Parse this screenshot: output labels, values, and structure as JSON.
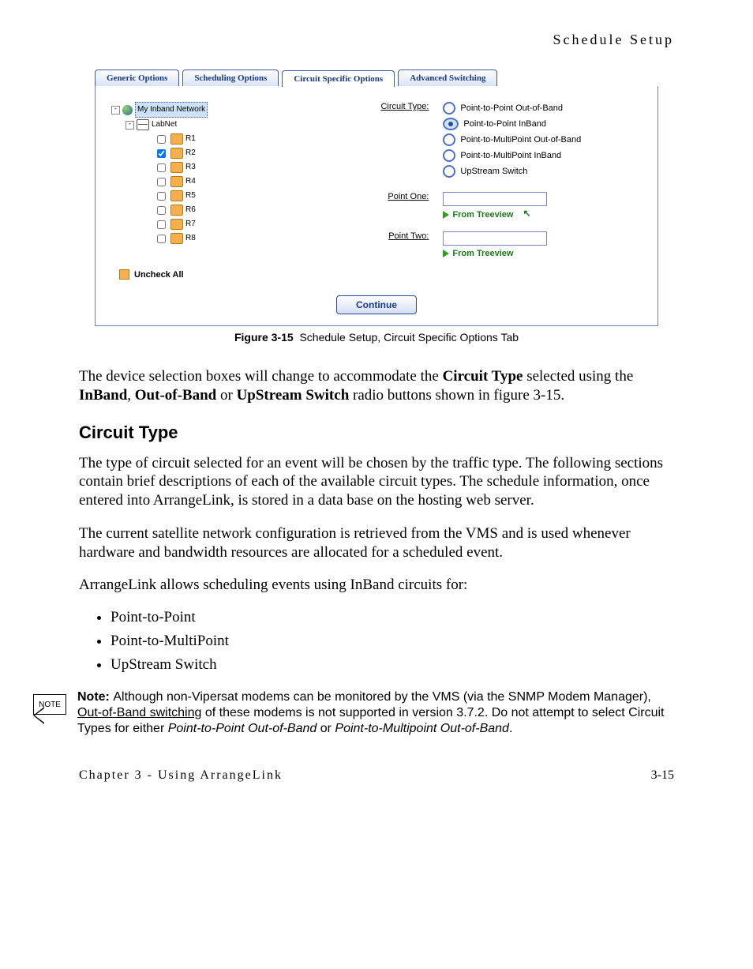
{
  "running_header": "Schedule Setup",
  "screenshot": {
    "tabs": [
      "Generic Options",
      "Scheduling Options",
      "Circuit Specific Options",
      "Advanced Switching"
    ],
    "active_tab_index": 2,
    "tree": {
      "root_label": "My Inband Network",
      "sub_label": "LabNet",
      "leaves": [
        {
          "label": "R1",
          "checked": false
        },
        {
          "label": "R2",
          "checked": true
        },
        {
          "label": "R3",
          "checked": false
        },
        {
          "label": "R4",
          "checked": false
        },
        {
          "label": "R5",
          "checked": false
        },
        {
          "label": "R6",
          "checked": false
        },
        {
          "label": "R7",
          "checked": false
        },
        {
          "label": "R8",
          "checked": false
        }
      ]
    },
    "uncheck_all_label": "Uncheck All",
    "circuit_type_label": "Circuit Type:",
    "circuit_types": [
      {
        "label": "Point-to-Point Out-of-Band",
        "selected": false
      },
      {
        "label": "Point-to-Point InBand",
        "selected": true
      },
      {
        "label": "Point-to-MultiPoint Out-of-Band",
        "selected": false
      },
      {
        "label": "Point-to-MultiPoint InBand",
        "selected": false
      },
      {
        "label": "UpStream Switch",
        "selected": false
      }
    ],
    "point_one_label": "Point One:",
    "point_two_label": "Point Two:",
    "from_treeview_label": "From Treeview",
    "continue_label": "Continue"
  },
  "figure": {
    "number": "Figure 3-15",
    "title": "Schedule Setup, Circuit Specific Options Tab"
  },
  "para1_a": "The device selection boxes will change to accommodate the ",
  "para1_b": "Circuit Type",
  "para1_c": " selected using the ",
  "para1_d": "InBand",
  "para1_e": ", ",
  "para1_f": "Out-of-Band",
  "para1_g": " or ",
  "para1_h": "UpStream Switch",
  "para1_i": " radio buttons shown in figure 3-15.",
  "sec_title": "Circuit Type",
  "para2": "The type of circuit selected for an event will be chosen by the traffic type. The following sections contain brief descriptions of each of the available circuit types. The schedule information, once entered into ArrangeLink, is stored in a data base on the hosting web server.",
  "para3": "The current satellite network configuration is retrieved from the VMS and is used whenever hardware and bandwidth resources are allocated for a scheduled event.",
  "para4": "ArrangeLink allows scheduling events using InBand circuits for:",
  "bullets": [
    "Point-to-Point",
    "Point-to-MultiPoint",
    "UpStream Switch"
  ],
  "note_badge": "NOTE",
  "note_lead": "Note:",
  "note_a": "Although non-Vipersat modems can be monitored by the VMS (via the SNMP Modem Manager), ",
  "note_b": "Out-of-Band switching",
  "note_c": " of these modems is not supported in version 3.7.2. Do not attempt to select Circuit Types for either ",
  "note_d": "Point-to-Point Out-of-Band",
  "note_e": " or ",
  "note_f": "Point-to-Multipoint Out-of-Band",
  "note_g": ".",
  "footer_chapter": "Chapter 3 - Using ArrangeLink",
  "footer_page": "3-15"
}
